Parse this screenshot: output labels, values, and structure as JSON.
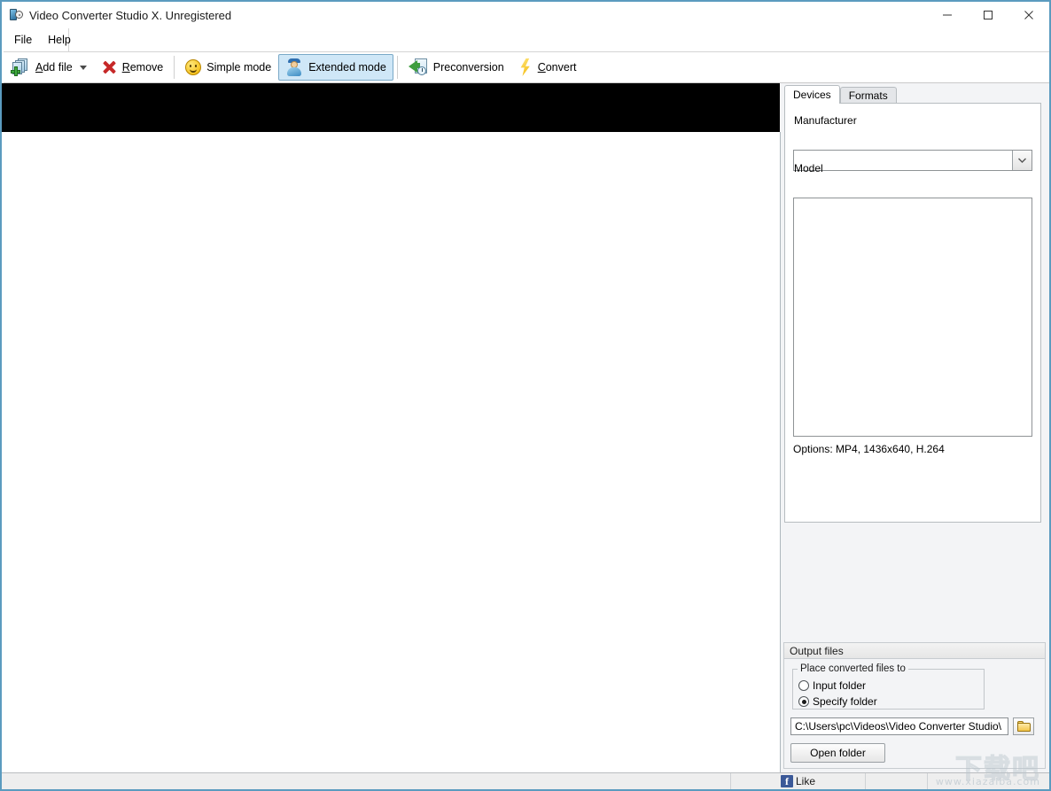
{
  "window": {
    "title": "Video Converter Studio X. Unregistered",
    "icon": "app-video-icon",
    "controls": {
      "minimize": "minimize-icon",
      "maximize": "maximize-icon",
      "close": "close-icon"
    }
  },
  "menu": {
    "items": [
      {
        "label": "File"
      },
      {
        "label": "Help"
      }
    ]
  },
  "toolbar": {
    "items": [
      {
        "label": "Add file",
        "icon": "add-file-icon",
        "underline": "A",
        "has_dropdown": true,
        "active": false
      },
      {
        "label": "Remove",
        "icon": "remove-x-icon",
        "underline": "R",
        "has_dropdown": false,
        "active": false
      },
      {
        "label": "Simple mode",
        "icon": "smiley-icon",
        "underline": "",
        "has_dropdown": false,
        "active": false
      },
      {
        "label": "Extended mode",
        "icon": "user-hat-icon",
        "underline": "",
        "has_dropdown": false,
        "active": true
      },
      {
        "label": "Preconversion",
        "icon": "preconversion-icon",
        "underline": "",
        "has_dropdown": false,
        "active": false
      },
      {
        "label": "Convert",
        "icon": "lightning-bolt-icon",
        "underline": "C",
        "has_dropdown": false,
        "active": false
      }
    ]
  },
  "right_panel": {
    "tabs": [
      {
        "label": "Devices",
        "selected": true
      },
      {
        "label": "Formats",
        "selected": false
      }
    ],
    "manufacturer": {
      "label": "Manufacturer",
      "value": "",
      "dropdown_icon": "chevron-down-icon"
    },
    "model": {
      "label": "Model",
      "value": ""
    },
    "options_text": "Options: MP4, 1436x640, H.264"
  },
  "output_files": {
    "group_title": "Output files",
    "place_group_title": "Place converted files to",
    "radios": [
      {
        "label": "Input folder",
        "selected": false
      },
      {
        "label": "Specify folder",
        "selected": true
      }
    ],
    "path_value": "C:\\Users\\pc\\Videos\\Video Converter Studio\\",
    "browse_icon": "folder-open-icon",
    "open_folder_label": "Open folder"
  },
  "status_bar": {
    "left_text": "",
    "like_label": "Like",
    "like_icon": "facebook-icon",
    "right_text": ""
  },
  "watermark": {
    "cn_text": "下载吧",
    "url_text": "www.xiazaiba.com"
  },
  "colors": {
    "window_border": "#5b9bbf",
    "active_toolbar_bg": "#cfe7f7",
    "preview_bg": "#000000",
    "panel_bg": "#f3f4f6",
    "facebook_blue": "#3b5998"
  }
}
